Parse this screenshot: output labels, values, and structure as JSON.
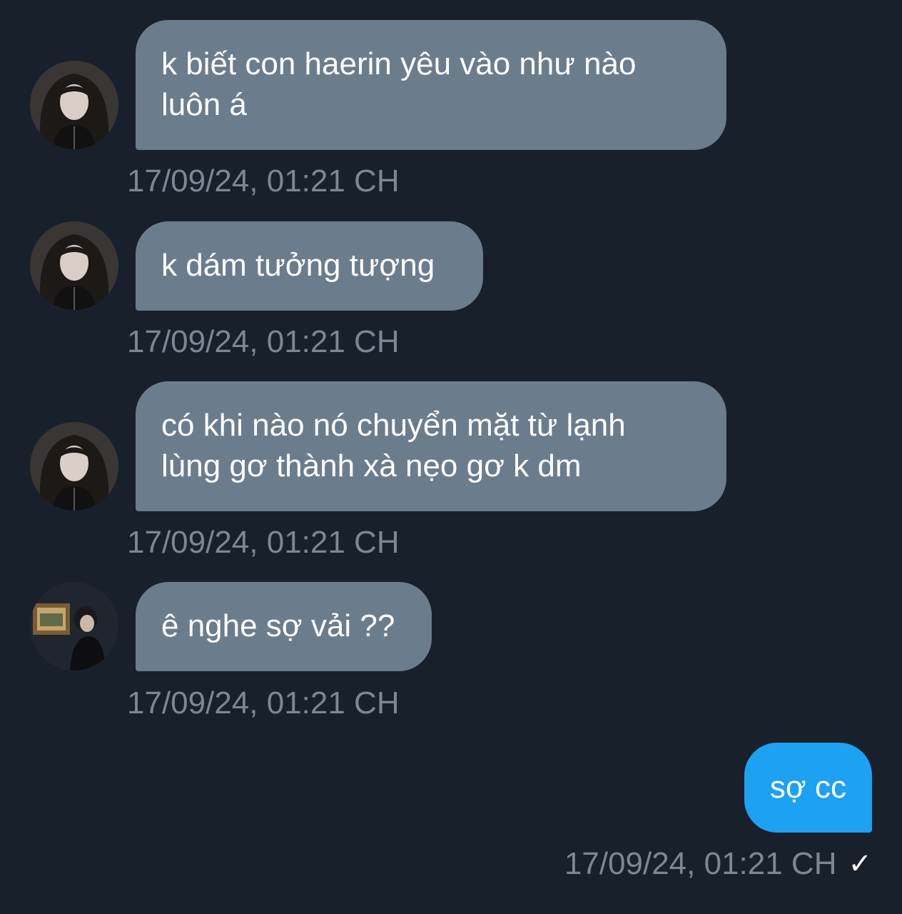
{
  "messages": [
    {
      "direction": "incoming",
      "avatar": "user-avatar-girl-long-hair",
      "text": "k biết con haerin yêu vào như nào\nluôn á",
      "timestamp": "17/09/24, 01:21 CH"
    },
    {
      "direction": "incoming",
      "avatar": "user-avatar-girl-long-hair",
      "text": "k dám tưởng tượng",
      "timestamp": "17/09/24, 01:21 CH"
    },
    {
      "direction": "incoming",
      "avatar": "user-avatar-girl-long-hair",
      "text": "có khi nào nó chuyển mặt từ lạnh\nlùng gơ thành xà nẹo gơ k dm",
      "timestamp": "17/09/24, 01:21 CH"
    },
    {
      "direction": "incoming",
      "avatar": "user-avatar-gallery-photo",
      "text": "ê nghe sợ vải ??",
      "timestamp": "17/09/24, 01:21 CH"
    },
    {
      "direction": "outgoing",
      "text": "sợ cc",
      "timestamp": "17/09/24, 01:21 CH",
      "status_icon": "check-icon"
    }
  ],
  "colors": {
    "background": "#18202b",
    "incoming_bubble": "#6b7c8d",
    "outgoing_bubble": "#1da1f2",
    "timestamp": "#7b8794"
  }
}
